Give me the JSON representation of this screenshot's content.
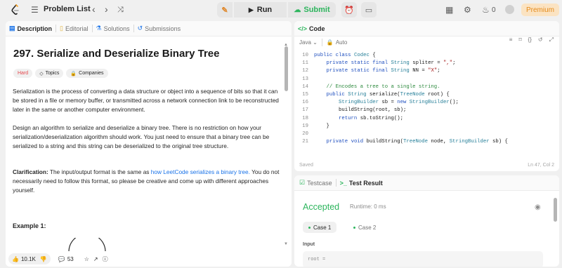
{
  "topbar": {
    "problem_list_label": "Problem List",
    "run_label": "Run",
    "submit_label": "Submit",
    "streak_count": "0",
    "premium_label": "Premium"
  },
  "left_tabs": [
    "Description",
    "Editorial",
    "Solutions",
    "Submissions"
  ],
  "problem": {
    "title": "297. Serialize and Deserialize Binary Tree",
    "difficulty": "Hard",
    "topics_label": "Topics",
    "companies_label": "Companies",
    "para1": "Serialization is the process of converting a data structure or object into a sequence of bits so that it can be stored in a file or memory buffer, or transmitted across a network connection link to be reconstructed later in the same or another computer environment.",
    "para2": "Design an algorithm to serialize and deserialize a binary tree. There is no restriction on how your serialization/deserialization algorithm should work. You just need to ensure that a binary tree can be serialized to a string and this string can be deserialized to the original tree structure.",
    "clarification_label": "Clarification:",
    "para3_pre": "The input/output format is the same as",
    "para3_link": "how LeetCode serializes a binary tree.",
    "para3_post": "You do not necessarily need to follow this format, so please be creative and come up with different approaches yourself.",
    "example_label": "Example 1:"
  },
  "bottom_bar": {
    "likes": "10.1K",
    "comments": "53"
  },
  "code_panel": {
    "title": "Code",
    "language": "Java",
    "auto_label": "Auto",
    "saved_label": "Saved",
    "cursor_pos": "Ln 47, Col 2",
    "lines": [
      {
        "n": "10",
        "t": "public class Codec {"
      },
      {
        "n": "11",
        "t": "    private static final String spliter = \",\";"
      },
      {
        "n": "12",
        "t": "    private static final String NN = \"X\";"
      },
      {
        "n": "13",
        "t": ""
      },
      {
        "n": "14",
        "t": "    // Encodes a tree to a single string."
      },
      {
        "n": "15",
        "t": "    public String serialize(TreeNode root) {"
      },
      {
        "n": "16",
        "t": "        StringBuilder sb = new StringBuilder();"
      },
      {
        "n": "17",
        "t": "        buildString(root, sb);"
      },
      {
        "n": "18",
        "t": "        return sb.toString();"
      },
      {
        "n": "19",
        "t": "    }"
      },
      {
        "n": "20",
        "t": ""
      },
      {
        "n": "21",
        "t": "    private void buildString(TreeNode node, StringBuilder sb) {"
      }
    ]
  },
  "result_panel": {
    "tab_testcase": "Testcase",
    "tab_result": "Test Result",
    "status": "Accepted",
    "runtime": "Runtime: 0 ms",
    "case1": "Case 1",
    "case2": "Case 2",
    "input_label": "Input",
    "input_value": "root ="
  }
}
